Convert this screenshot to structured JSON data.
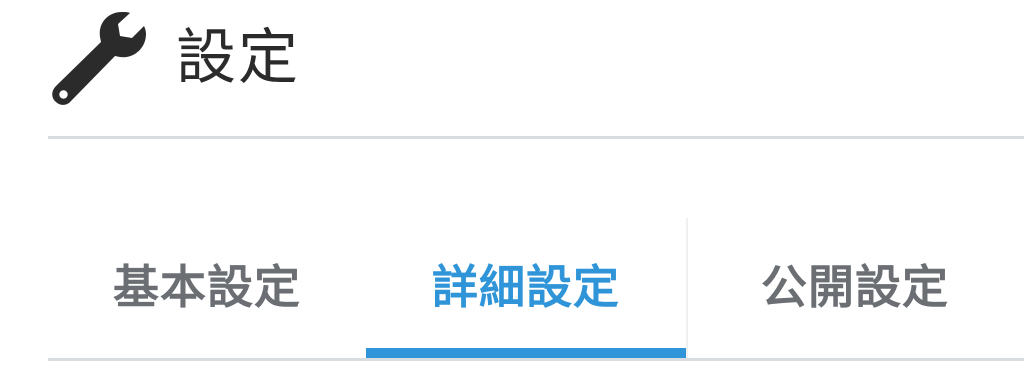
{
  "header": {
    "icon": "wrench-icon",
    "title": "設定"
  },
  "tabs": [
    {
      "label": "基本設定",
      "active": false
    },
    {
      "label": "詳細設定",
      "active": true
    },
    {
      "label": "公開設定",
      "active": false
    }
  ],
  "colors": {
    "accent": "#2f95d8",
    "inactive_tab_text": "#6b6f73",
    "title_text": "#2b2b2b",
    "divider": "#d8dde1",
    "icon": "#2b2b2b"
  }
}
